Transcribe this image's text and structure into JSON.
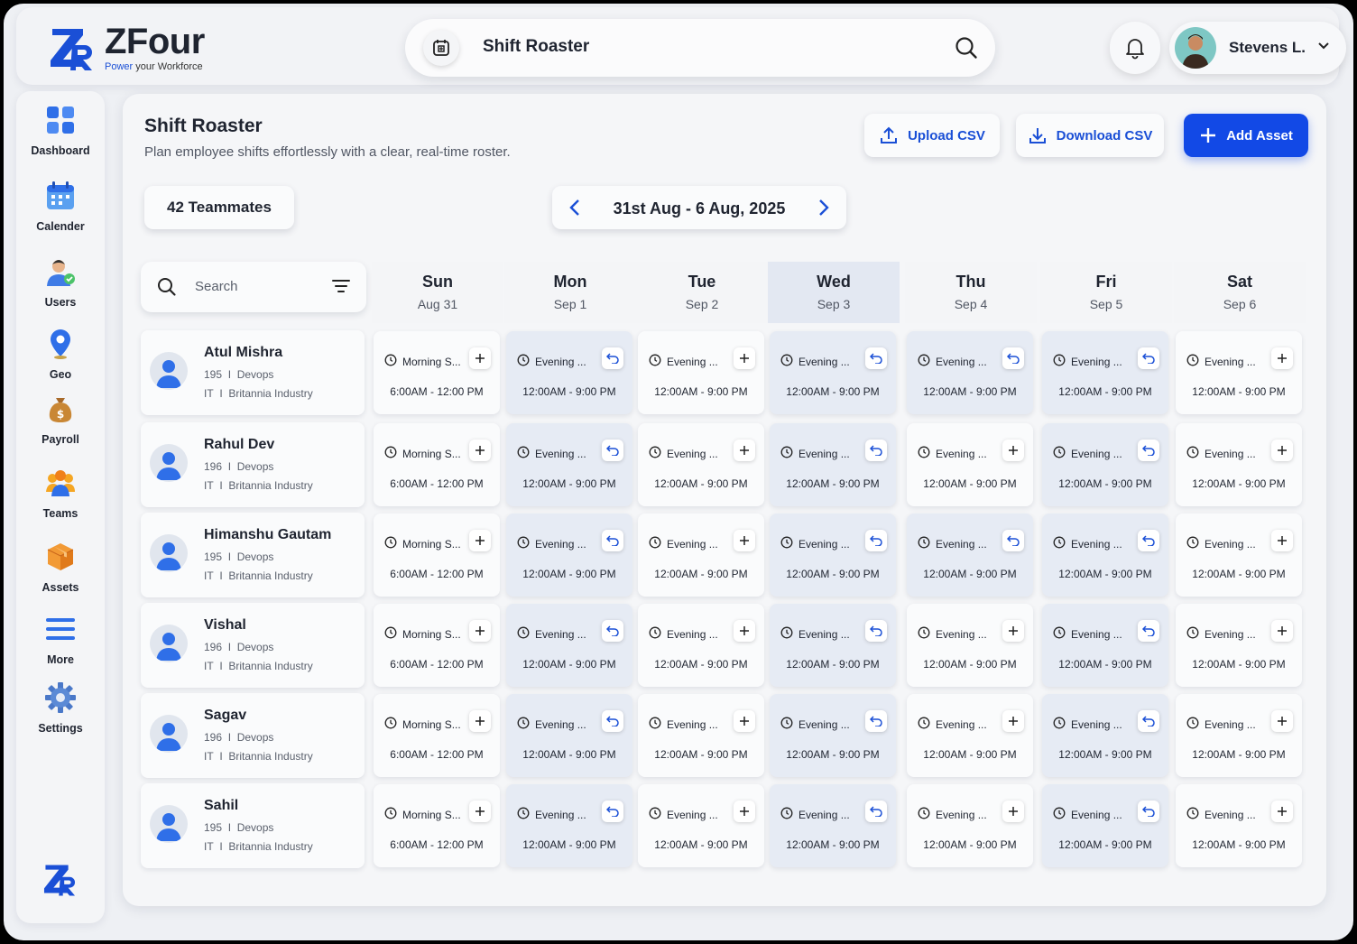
{
  "app": {
    "name": "ZFour",
    "tag_prefix": "Power",
    "tag_suffix": " your Workforce"
  },
  "search": {
    "title": "Shift Roaster"
  },
  "user": {
    "name": "Stevens L."
  },
  "sidebar": {
    "items": [
      {
        "label": "Dashboard",
        "icon": "dashboard-icon"
      },
      {
        "label": "Calender",
        "icon": "calendar-icon"
      },
      {
        "label": "Users",
        "icon": "users-icon"
      },
      {
        "label": "Geo",
        "icon": "location-pin-icon"
      },
      {
        "label": "Payroll",
        "icon": "money-bag-icon"
      },
      {
        "label": "Teams",
        "icon": "teams-icon"
      },
      {
        "label": "Assets",
        "icon": "box-icon"
      },
      {
        "label": "More",
        "icon": "menu-icon"
      },
      {
        "label": "Settings",
        "icon": "gear-icon"
      }
    ]
  },
  "page": {
    "title": "Shift Roaster",
    "subtitle": "Plan employee shifts effortlessly with a clear, real-time roster.",
    "upload": "Upload CSV",
    "download": "Download CSV",
    "add": "Add Asset",
    "teammates": "42 Teammates",
    "range": "31st Aug - 6 Aug, 2025",
    "search_placeholder": "Search"
  },
  "days": [
    {
      "name": "Sun",
      "date": "Aug 31"
    },
    {
      "name": "Mon",
      "date": "Sep 1"
    },
    {
      "name": "Tue",
      "date": "Sep 2"
    },
    {
      "name": "Wed",
      "date": "Sep 3",
      "highlight": true
    },
    {
      "name": "Thu",
      "date": "Sep 4"
    },
    {
      "name": "Fri",
      "date": "Sep 5"
    },
    {
      "name": "Sat",
      "date": "Sep 6"
    }
  ],
  "employees": [
    {
      "name": "Atul Mishra",
      "id": "195",
      "role": "Devops",
      "dept": "IT",
      "company": "Britannia Industry",
      "shifts": [
        {
          "label": "Morning S...",
          "time": "6:00AM - 12:00 PM",
          "action": "add"
        },
        {
          "label": "Evening ...",
          "time": "12:00AM - 9:00 PM",
          "action": "swap"
        },
        {
          "label": "Evening ...",
          "time": "12:00AM - 9:00 PM",
          "action": "add"
        },
        {
          "label": "Evening ...",
          "time": "12:00AM - 9:00 PM",
          "action": "swap"
        },
        {
          "label": "Evening ...",
          "time": "12:00AM - 9:00 PM",
          "action": "swap"
        },
        {
          "label": "Evening ...",
          "time": "12:00AM - 9:00 PM",
          "action": "swap"
        },
        {
          "label": "Evening ...",
          "time": "12:00AM - 9:00 PM",
          "action": "add"
        }
      ]
    },
    {
      "name": "Rahul Dev",
      "id": "196",
      "role": "Devops",
      "dept": "IT",
      "company": "Britannia Industry",
      "shifts": [
        {
          "label": "Morning S...",
          "time": "6:00AM - 12:00 PM",
          "action": "add"
        },
        {
          "label": "Evening ...",
          "time": "12:00AM - 9:00 PM",
          "action": "swap"
        },
        {
          "label": "Evening ...",
          "time": "12:00AM - 9:00 PM",
          "action": "add"
        },
        {
          "label": "Evening ...",
          "time": "12:00AM - 9:00 PM",
          "action": "swap"
        },
        {
          "label": "Evening ...",
          "time": "12:00AM - 9:00 PM",
          "action": "add"
        },
        {
          "label": "Evening ...",
          "time": "12:00AM - 9:00 PM",
          "action": "swap"
        },
        {
          "label": "Evening ...",
          "time": "12:00AM - 9:00 PM",
          "action": "add"
        }
      ]
    },
    {
      "name": "Himanshu Gautam",
      "id": "195",
      "role": "Devops",
      "dept": "IT",
      "company": "Britannia Industry",
      "shifts": [
        {
          "label": "Morning S...",
          "time": "6:00AM - 12:00 PM",
          "action": "add"
        },
        {
          "label": "Evening ...",
          "time": "12:00AM - 9:00 PM",
          "action": "swap"
        },
        {
          "label": "Evening ...",
          "time": "12:00AM - 9:00 PM",
          "action": "add"
        },
        {
          "label": "Evening ...",
          "time": "12:00AM - 9:00 PM",
          "action": "swap"
        },
        {
          "label": "Evening ...",
          "time": "12:00AM - 9:00 PM",
          "action": "swap"
        },
        {
          "label": "Evening ...",
          "time": "12:00AM - 9:00 PM",
          "action": "swap"
        },
        {
          "label": "Evening ...",
          "time": "12:00AM - 9:00 PM",
          "action": "add"
        }
      ]
    },
    {
      "name": "Vishal",
      "id": "196",
      "role": "Devops",
      "dept": "IT",
      "company": "Britannia Industry",
      "shifts": [
        {
          "label": "Morning S...",
          "time": "6:00AM - 12:00 PM",
          "action": "add"
        },
        {
          "label": "Evening ...",
          "time": "12:00AM - 9:00 PM",
          "action": "swap"
        },
        {
          "label": "Evening ...",
          "time": "12:00AM - 9:00 PM",
          "action": "add"
        },
        {
          "label": "Evening ...",
          "time": "12:00AM - 9:00 PM",
          "action": "swap"
        },
        {
          "label": "Evening ...",
          "time": "12:00AM - 9:00 PM",
          "action": "add"
        },
        {
          "label": "Evening ...",
          "time": "12:00AM - 9:00 PM",
          "action": "swap"
        },
        {
          "label": "Evening ...",
          "time": "12:00AM - 9:00 PM",
          "action": "add"
        }
      ]
    },
    {
      "name": "Sagav",
      "id": "196",
      "role": "Devops",
      "dept": "IT",
      "company": "Britannia Industry",
      "shifts": [
        {
          "label": "Morning S...",
          "time": "6:00AM - 12:00 PM",
          "action": "add"
        },
        {
          "label": "Evening ...",
          "time": "12:00AM - 9:00 PM",
          "action": "swap"
        },
        {
          "label": "Evening ...",
          "time": "12:00AM - 9:00 PM",
          "action": "add"
        },
        {
          "label": "Evening ...",
          "time": "12:00AM - 9:00 PM",
          "action": "swap"
        },
        {
          "label": "Evening ...",
          "time": "12:00AM - 9:00 PM",
          "action": "add"
        },
        {
          "label": "Evening ...",
          "time": "12:00AM - 9:00 PM",
          "action": "swap"
        },
        {
          "label": "Evening ...",
          "time": "12:00AM - 9:00 PM",
          "action": "add"
        }
      ]
    },
    {
      "name": "Sahil",
      "id": "195",
      "role": "Devops",
      "dept": "IT",
      "company": "Britannia Industry",
      "shifts": [
        {
          "label": "Morning S...",
          "time": "6:00AM - 12:00 PM",
          "action": "add"
        },
        {
          "label": "Evening ...",
          "time": "12:00AM - 9:00 PM",
          "action": "swap"
        },
        {
          "label": "Evening ...",
          "time": "12:00AM - 9:00 PM",
          "action": "add"
        },
        {
          "label": "Evening ...",
          "time": "12:00AM - 9:00 PM",
          "action": "swap"
        },
        {
          "label": "Evening ...",
          "time": "12:00AM - 9:00 PM",
          "action": "add"
        },
        {
          "label": "Evening ...",
          "time": "12:00AM - 9:00 PM",
          "action": "swap"
        },
        {
          "label": "Evening ...",
          "time": "12:00AM - 9:00 PM",
          "action": "add"
        }
      ]
    }
  ],
  "colors": {
    "accent": "#1249e6",
    "swap_cell": "#e6ebf4",
    "today_header": "#e3e8f2"
  }
}
